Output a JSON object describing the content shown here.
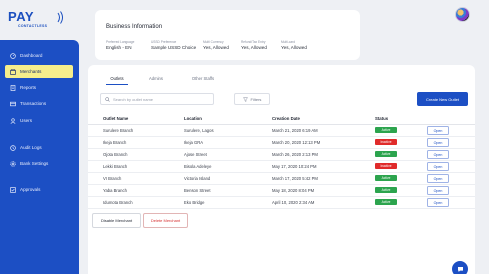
{
  "brand": {
    "logo_word": "PAY",
    "logo_sub": "CONTACTLESS"
  },
  "header": {
    "avatar_icon": "user-avatar"
  },
  "sidebar": {
    "items": [
      {
        "label": "Dashboard",
        "icon": "dashboard-icon",
        "active": false
      },
      {
        "label": "Merchants",
        "icon": "merchants-icon",
        "active": true
      },
      {
        "label": "Reports",
        "icon": "reports-icon",
        "active": false
      },
      {
        "label": "Transactions",
        "icon": "transactions-icon",
        "active": false
      },
      {
        "label": "Users",
        "icon": "users-icon",
        "active": false
      },
      {
        "label": "Audit Logs",
        "icon": "audit-icon",
        "active": false
      },
      {
        "label": "Bank Settings",
        "icon": "settings-icon",
        "active": false
      },
      {
        "label": "Approvals",
        "icon": "approvals-icon",
        "active": false
      }
    ]
  },
  "business_info": {
    "title": "Business Information",
    "fields": [
      {
        "label": "Preferred Language",
        "value": "English - EN"
      },
      {
        "label": "USSD Preference",
        "value": "Sample USSD Choice"
      },
      {
        "label": "Multi Currency",
        "value": "Yes, Allowed"
      },
      {
        "label": "Refund/Tax Entry",
        "value": "Yes, Allowed"
      },
      {
        "label": "Multi-card",
        "value": "Yes, Allowed"
      }
    ]
  },
  "tabs": [
    {
      "label": "Outlets",
      "active": true
    },
    {
      "label": "Admins",
      "active": false
    },
    {
      "label": "Other Staffs",
      "active": false
    }
  ],
  "search": {
    "placeholder": "Search by outlet name"
  },
  "filters_label": "Filters",
  "create_button": "Create New Outlet",
  "table": {
    "headers": [
      "Outlet Name",
      "Location",
      "Creation Date",
      "Status"
    ],
    "rows": [
      {
        "name": "Surulere Branch",
        "location": "Surulere, Lagos",
        "date": "March 21, 2020 6:19 AM",
        "status": "Active",
        "action": "Open"
      },
      {
        "name": "Ikeja Branch",
        "location": "Ikeja GRA",
        "date": "March 20, 2020 12:13 PM",
        "status": "Inactive",
        "action": "Open"
      },
      {
        "name": "Ojota Branch",
        "location": "Ajose Street",
        "date": "March 26, 2020 2:13 PM",
        "status": "Active",
        "action": "Open"
      },
      {
        "name": "Lekki Branch",
        "location": "Bisola Adeleye",
        "date": "May 17, 2020 10:24 PM",
        "status": "Inactive",
        "action": "Open"
      },
      {
        "name": "VI Branch",
        "location": "Victoria Island",
        "date": "March 17, 2020 5:42 PM",
        "status": "Active",
        "action": "Open"
      },
      {
        "name": "Yaba Branch",
        "location": "Benson Street",
        "date": "May 18, 2020 8:04 PM",
        "status": "Active",
        "action": "Open"
      },
      {
        "name": "Idumota Branch",
        "location": "Eko Bridge",
        "date": "April 10, 2020 2:34 AM",
        "status": "Active",
        "action": "Open"
      }
    ]
  },
  "footer_buttons": {
    "disable": "Disable Merchant",
    "delete": "Delete Merchant"
  },
  "colors": {
    "primary": "#1c4fc4",
    "active": "#2ca44e",
    "inactive": "#e02b2b",
    "sidebar_active_bg": "#f6ee8c"
  },
  "chat": {
    "icon": "chat-icon"
  }
}
